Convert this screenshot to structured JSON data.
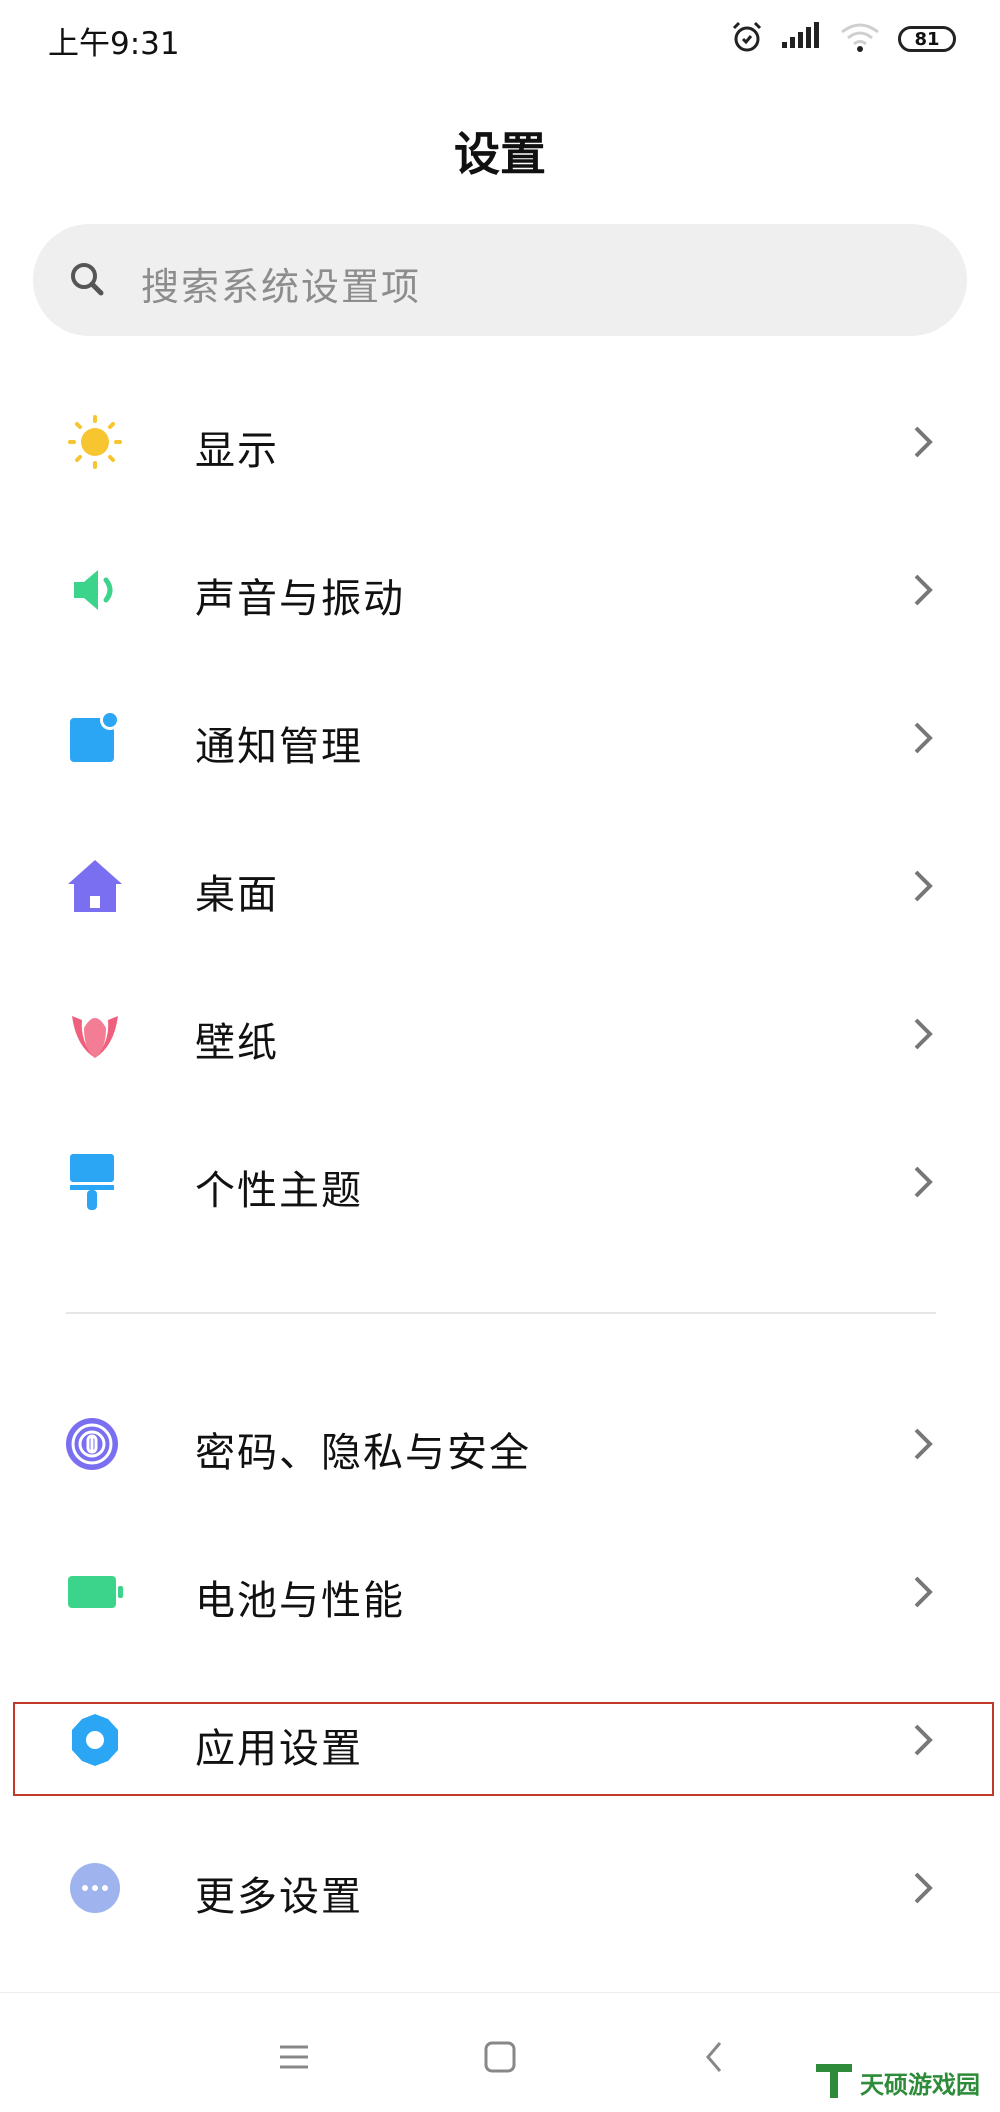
{
  "status_bar": {
    "time": "上午9:31",
    "battery": "81"
  },
  "title": "设置",
  "search": {
    "placeholder": "搜索系统设置项"
  },
  "settings": [
    {
      "label": "显示",
      "icon": "sun-icon",
      "color": "#f7c530"
    },
    {
      "label": "声音与振动",
      "icon": "speaker-icon",
      "color": "#3bd48a"
    },
    {
      "label": "通知管理",
      "icon": "notification-icon",
      "color": "#2aa6f5"
    },
    {
      "label": "桌面",
      "icon": "home-icon",
      "color": "#7a6ff0"
    },
    {
      "label": "壁纸",
      "icon": "tulip-icon",
      "color": "#f0607e"
    },
    {
      "label": "个性主题",
      "icon": "brush-icon",
      "color": "#2aa6f5"
    },
    {
      "label": "密码、隐私与安全",
      "icon": "fingerprint-icon",
      "color": "#7a6ff0"
    },
    {
      "label": "电池与性能",
      "icon": "battery-icon",
      "color": "#3bd48a"
    },
    {
      "label": "应用设置",
      "icon": "gear-icon",
      "color": "#2aa6f5"
    },
    {
      "label": "更多设置",
      "icon": "more-icon",
      "color": "#9fb3ef"
    }
  ],
  "watermark": {
    "text": "天硕游戏园"
  }
}
